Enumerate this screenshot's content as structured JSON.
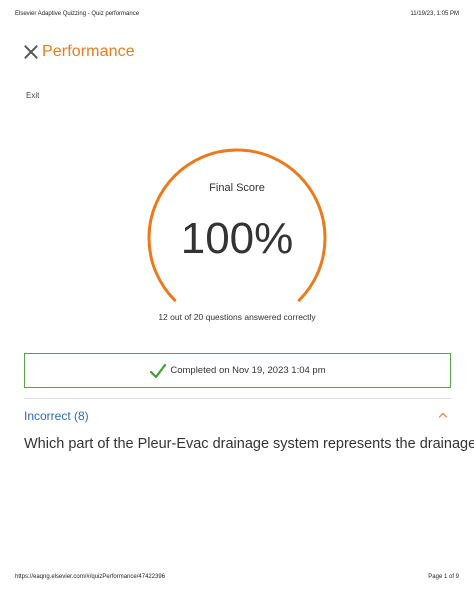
{
  "print_header": {
    "left": "Elsevier Adaptive Quizzing - Quiz performance",
    "right": "11/19/23, 1:05 PM"
  },
  "header": {
    "title": "Performance",
    "exit_label": "Exit"
  },
  "score": {
    "label": "Final Score",
    "value": "100%",
    "fill_fraction": 1.0,
    "answered_text": "12 out of 20 questions answered correctly"
  },
  "completed": {
    "text": "Completed on Nov 19, 2023 1:04 pm"
  },
  "incorrect": {
    "label": "Incorrect (8)",
    "question": "Which part of the Pleur-Evac drainage system represents the drainage"
  },
  "print_footer": {
    "left": "https://eaqng.elsevier.com/#/quizPerformance/47422396",
    "right": "Page 1 of 9"
  },
  "colors": {
    "accent": "#ec7a1c",
    "success": "#5aa14a",
    "link": "#2b6cb0"
  },
  "icons": {
    "close": "close-icon",
    "check": "check-icon",
    "collapse": "chevron-up-icon"
  }
}
